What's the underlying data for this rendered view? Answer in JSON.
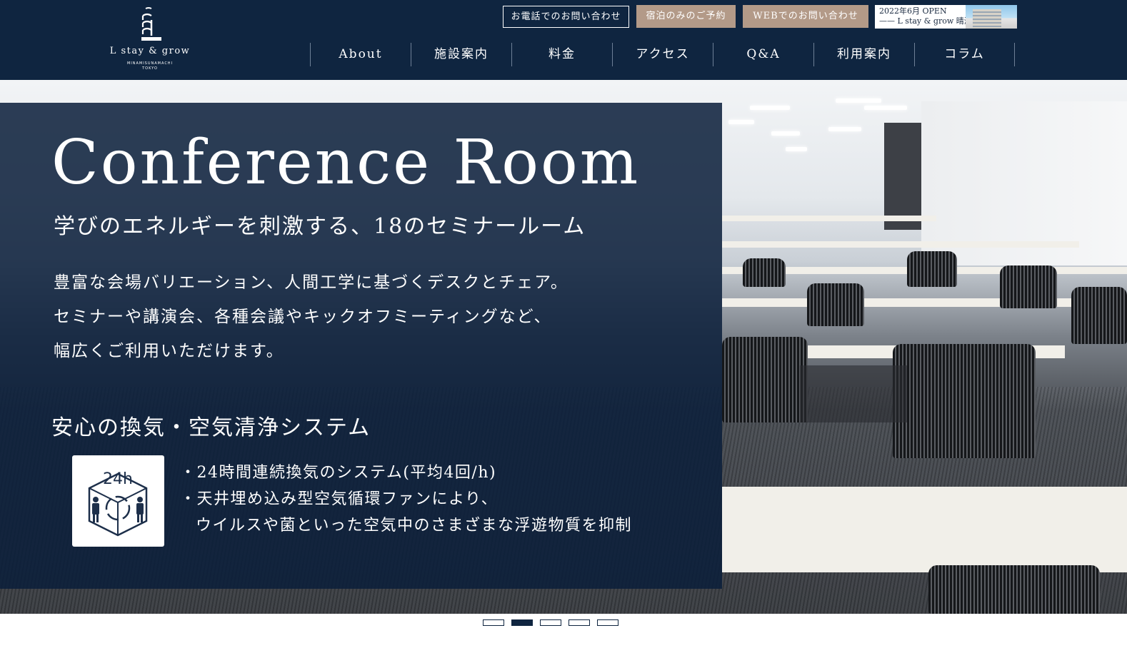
{
  "header": {
    "logo": {
      "name": "L stay & grow",
      "subtitle_line1": "MINAMISUNAMACHI",
      "subtitle_line2": "TOKYO"
    },
    "top_links": {
      "phone": "お電話でのお問い合わせ",
      "stay_booking": "宿泊のみのご予約",
      "web_inquiry": "WEBでのお問い合わせ"
    },
    "open_banner": {
      "line1": "2022年6月 OPEN",
      "line2": "—— L stay & grow 晴海"
    },
    "nav": [
      "About",
      "施設案内",
      "料金",
      "アクセス",
      "Q&A",
      "利用案内",
      "コラム"
    ]
  },
  "hero": {
    "title": "Conference Room",
    "subtitle": "学びのエネルギーを刺激する、18のセミナールーム",
    "description": [
      "豊富な会場バリエーション、人間工学に基づくデスクとチェア。",
      "セミナーや講演会、各種会議やキックオフミーティングなど、",
      "幅広くご利用いただけます。"
    ],
    "ventilation": {
      "heading": "安心の換気・空気清浄システム",
      "icon_label": "24h",
      "items": [
        "・24時間連続換気のシステム(平均4回/h)",
        "・天井埋め込み型空気循環ファンにより、",
        "ウイルスや菌といった空気中のさまざまな浮遊物質を抑制"
      ]
    }
  },
  "pager": {
    "count": 5,
    "active_index": 1
  },
  "colors": {
    "navy": "#0f2540",
    "accent_beige": "#b39a88",
    "white": "#ffffff"
  }
}
